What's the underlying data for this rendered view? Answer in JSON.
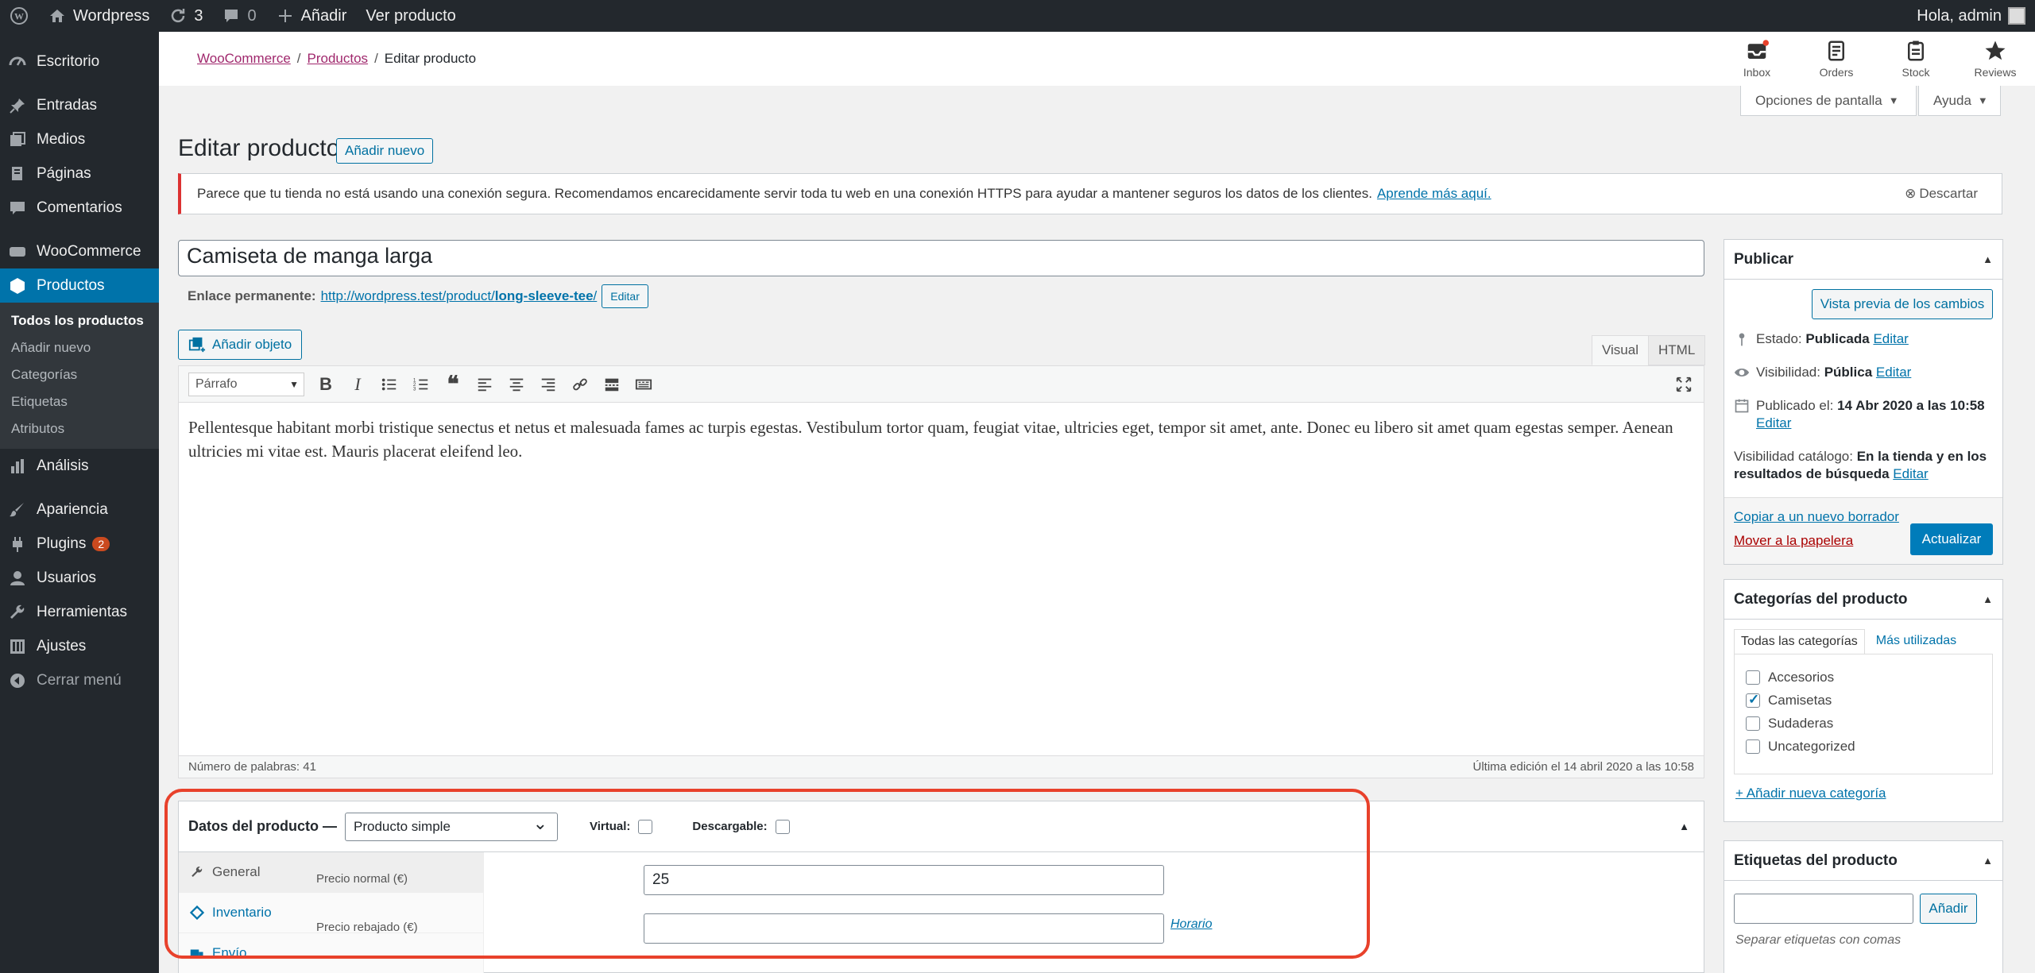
{
  "admin_bar": {
    "site_name": "Wordpress",
    "updates_count": "3",
    "comments_count": "0",
    "add_label": "Añadir",
    "view_product": "Ver producto",
    "greeting": "Hola, admin"
  },
  "sidebar": {
    "items": [
      {
        "label": "Escritorio",
        "icon": "dashboard-icon"
      },
      {
        "label": "Entradas",
        "icon": "pin-icon"
      },
      {
        "label": "Medios",
        "icon": "media-icon"
      },
      {
        "label": "Páginas",
        "icon": "page-icon"
      },
      {
        "label": "Comentarios",
        "icon": "comment-icon"
      },
      {
        "label": "WooCommerce",
        "icon": "woo-icon"
      },
      {
        "label": "Productos",
        "icon": "product-icon"
      },
      {
        "label": "Análisis",
        "icon": "chart-icon"
      },
      {
        "label": "Apariencia",
        "icon": "brush-icon"
      },
      {
        "label": "Plugins",
        "icon": "plug-icon",
        "badge": "2"
      },
      {
        "label": "Usuarios",
        "icon": "user-icon"
      },
      {
        "label": "Herramientas",
        "icon": "wrench-icon"
      },
      {
        "label": "Ajustes",
        "icon": "settings-icon"
      },
      {
        "label": "Cerrar menú",
        "icon": "collapse-icon"
      }
    ],
    "submenu": [
      "Todos los productos",
      "Añadir nuevo",
      "Categorías",
      "Etiquetas",
      "Atributos"
    ]
  },
  "breadcrumb": {
    "woocommerce": "WooCommerce",
    "productos": "Productos",
    "current": "Editar producto"
  },
  "wc_nav": [
    "Inbox",
    "Orders",
    "Stock",
    "Reviews"
  ],
  "screen_options": "Opciones de pantalla",
  "help": "Ayuda",
  "page": {
    "title": "Editar producto",
    "add_new": "Añadir nuevo"
  },
  "notice": {
    "text": "Parece que tu tienda no está usando una conexión segura. Recomendamos encarecidamente servir toda tu web en una conexión HTTPS para ayudar a mantener seguros los datos de los clientes.",
    "link": "Aprende más aquí.",
    "dismiss": "Descartar"
  },
  "post": {
    "title": "Camiseta de manga larga",
    "permalink_label": "Enlace permanente:",
    "permalink_base": "http://wordpress.test/product/",
    "permalink_slug": "long-sleeve-tee",
    "permalink_end": "/",
    "edit": "Editar"
  },
  "editor": {
    "add_media": "Añadir objeto",
    "tab_visual": "Visual",
    "tab_html": "HTML",
    "format": "Párrafo",
    "content": "Pellentesque habitant morbi tristique senectus et netus et malesuada fames ac turpis egestas. Vestibulum tortor quam, feugiat vitae, ultricies eget, tempor sit amet, ante. Donec eu libero sit amet quam egestas semper. Aenean ultricies mi vitae est. Mauris placerat eleifend leo.",
    "word_count": "Número de palabras: 41",
    "last_edit": "Última edición el 14 abril 2020 a las 10:58"
  },
  "product_data": {
    "label": "Datos del producto —",
    "type": "Producto simple",
    "virtual": "Virtual:",
    "downloadable": "Descargable:",
    "tabs": [
      "General",
      "Inventario",
      "Envío"
    ],
    "regular_price_label": "Precio normal (€)",
    "regular_price": "25",
    "sale_price_label": "Precio rebajado (€)",
    "sale_price": "",
    "schedule": "Horario"
  },
  "publish": {
    "title": "Publicar",
    "preview": "Vista previa de los cambios",
    "status_label": "Estado:",
    "status": "Publicada",
    "visibility_label": "Visibilidad:",
    "visibility": "Pública",
    "published_label": "Publicado el:",
    "published": "14 Abr 2020 a las 10:58",
    "catalog_label": "Visibilidad catálogo:",
    "catalog": "En la tienda y en los resultados de búsqueda",
    "edit": "Editar",
    "copy_draft": "Copiar a un nuevo borrador",
    "trash": "Mover a la papelera",
    "update": "Actualizar"
  },
  "categories": {
    "title": "Categorías del producto",
    "tab_all": "Todas las categorías",
    "tab_popular": "Más utilizadas",
    "items": [
      {
        "name": "Accesorios",
        "checked": false
      },
      {
        "name": "Camisetas",
        "checked": true
      },
      {
        "name": "Sudaderas",
        "checked": false
      },
      {
        "name": "Uncategorized",
        "checked": false
      }
    ],
    "add_new": "+ Añadir nueva categoría"
  },
  "tags": {
    "title": "Etiquetas del producto",
    "add": "Añadir",
    "hint": "Separar etiquetas con comas"
  },
  "colors": {
    "accent": "#0073aa",
    "callout": "#e8412b",
    "woo": "#a0286d"
  }
}
